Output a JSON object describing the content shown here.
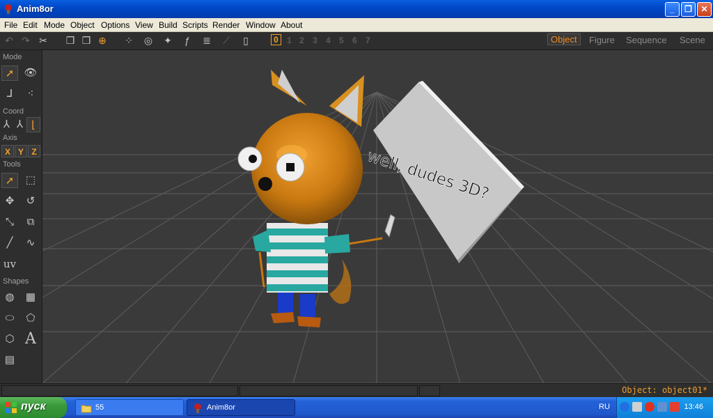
{
  "window": {
    "title": "Anim8or"
  },
  "menu": [
    "File",
    "Edit",
    "Mode",
    "Object",
    "Options",
    "View",
    "Build",
    "Scripts",
    "Render",
    "Window",
    "About"
  ],
  "toolbar": {
    "frame_numbers": [
      "0",
      "1",
      "2",
      "3",
      "4",
      "5",
      "6",
      "7"
    ]
  },
  "mode_tabs": [
    "Object",
    "Figure",
    "Sequence",
    "Scene"
  ],
  "left_panel": {
    "sections": [
      "Mode",
      "Coord",
      "Axis",
      "Tools",
      "Shapes"
    ],
    "axes": [
      "X",
      "Y",
      "Z"
    ],
    "uv_label": "uv",
    "text_tool": "A"
  },
  "viewport": {
    "sign_text": "well, dudes 3D?"
  },
  "status": {
    "text": "Object: object01*"
  },
  "taskbar": {
    "start_label": "пуск",
    "tasks": [
      {
        "label": "55"
      },
      {
        "label": "Anim8or"
      }
    ],
    "language": "RU",
    "clock": "13:46"
  },
  "colors": {
    "accent": "#f0a030",
    "viewport_bg": "#3a3a3a",
    "panel_bg": "#2e2e2e"
  }
}
